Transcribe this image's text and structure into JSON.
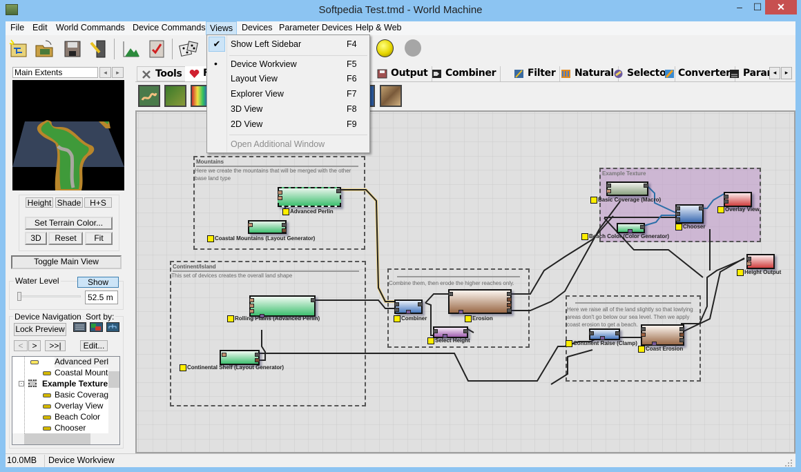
{
  "window": {
    "title": "Softpedia Test.tmd - World Machine",
    "minimize_glyph": "–",
    "maximize_glyph": "☐",
    "close_glyph": "✕"
  },
  "menubar": {
    "items": [
      "File",
      "Edit",
      "World Commands",
      "Device Commands",
      "Views",
      "Devices",
      "Parameter Devices",
      "Help & Web"
    ],
    "active_index": 4
  },
  "toolbar": {
    "icons": [
      "new-world-icon",
      "open-world-icon",
      "save-icon",
      "export-icon",
      "terrain-build-icon",
      "settings-checklist-icon",
      "random-dice-icon",
      "status-light-yellow-icon",
      "status-light-gray-icon"
    ]
  },
  "views_menu": {
    "items": [
      {
        "label": "Show Left Sidebar",
        "shortcut": "F4",
        "mark": "✔",
        "enabled": true
      },
      {
        "label": "Device Workview",
        "shortcut": "F5",
        "mark": "•",
        "enabled": true
      },
      {
        "label": "Layout View",
        "shortcut": "F6",
        "mark": "",
        "enabled": true
      },
      {
        "label": "Explorer View",
        "shortcut": "F7",
        "mark": "",
        "enabled": true
      },
      {
        "label": "3D View",
        "shortcut": "F8",
        "mark": "",
        "enabled": true
      },
      {
        "label": "2D View",
        "shortcut": "F9",
        "mark": "",
        "enabled": true
      },
      {
        "label": "Open Additional Window",
        "shortcut": "",
        "mark": "",
        "enabled": false
      }
    ]
  },
  "sidebar": {
    "extents_label": "Main Extents",
    "prev_glyph": "◂",
    "next_glyph": "▸",
    "view_buttons": [
      "Height",
      "Shade",
      "H+S"
    ],
    "set_terrain_color": "Set Terrain Color...",
    "camera_buttons": [
      "3D",
      "Reset",
      "Fit"
    ],
    "toggle_main_view": "Toggle Main View",
    "water_level": {
      "label": "Water Level",
      "show_button": "Show",
      "value": "52.5 m",
      "slider_fraction": 0.0
    },
    "device_navigation": {
      "label": "Device Navigation",
      "sort_label": "Sort by:",
      "lock_preview": "Lock Preview",
      "nav_buttons": [
        "<",
        ">",
        ">>|"
      ],
      "edit_button": "Edit..."
    },
    "tree": [
      {
        "label": "Advanced Perlin",
        "level": 2,
        "bold": false
      },
      {
        "label": "Coastal Mountai",
        "level": 2,
        "bold": false
      },
      {
        "label": "Example Texture",
        "level": 1,
        "bold": true
      },
      {
        "label": "Basic Coverage",
        "level": 2,
        "bold": false
      },
      {
        "label": "Overlay View",
        "level": 2,
        "bold": false
      },
      {
        "label": "Beach Color",
        "level": 2,
        "bold": false
      },
      {
        "label": "Chooser",
        "level": 2,
        "bold": false
      }
    ]
  },
  "device_tabs": {
    "items": [
      "Tools",
      "F",
      "Output",
      "Combiner",
      "Filter",
      "Natural",
      "Selector",
      "Converter",
      "Paran"
    ],
    "scroll_left": "◂",
    "scroll_right": "▸"
  },
  "workview": {
    "groups": [
      {
        "title": "Mountains",
        "description": "Here we create the mountains that will be merged with the other base land type"
      },
      {
        "title": "Continent/Island",
        "description": "This set of devices creates the overall land shape"
      },
      {
        "title": "",
        "description": "Combine them, then erode the higher reaches only."
      },
      {
        "title": "",
        "description": "Here we raise all of the land slightly so that lowlying areas don't go below our sea level. Then we apply coast erosion to get a beach."
      },
      {
        "title": "Example Texture",
        "description": ""
      }
    ],
    "nodes": [
      "Advanced Perlin",
      "Coastal Mountains (Layout Generator)",
      "Rolling Plains (Advanced Perlin)",
      "Continental Shelf (Layout Generator)",
      "Combiner",
      "Erosion",
      "Select Height",
      "Continent Raise (Clamp)",
      "Coast Erosion",
      "Basic Coverage (Macro)",
      "Beach Color (Color Generator)",
      "Chooser",
      "Overlay View",
      "Height Output"
    ]
  },
  "statusbar": {
    "memory": "10.0MB",
    "view": "Device Workview"
  }
}
